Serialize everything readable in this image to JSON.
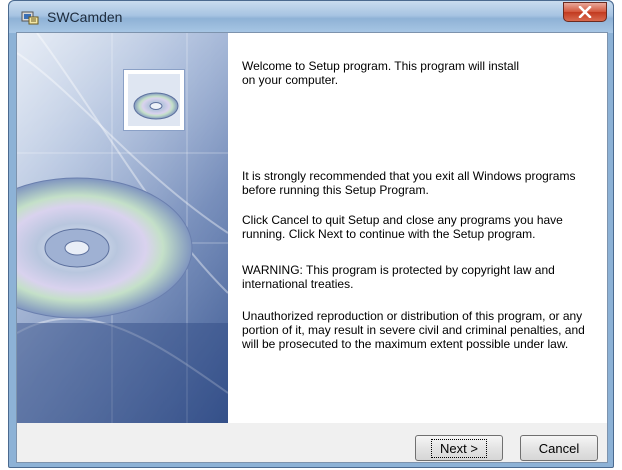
{
  "window": {
    "title": "SWCamden"
  },
  "content": {
    "paragraphs": [
      "Welcome to  Setup program. This program will install\n on your computer.",
      "It is strongly recommended that you exit all Windows programs\nbefore running this Setup Program.",
      "Click Cancel to quit Setup and close any programs you have\nrunning.  Click Next to continue with the Setup program.",
      "WARNING: This program is protected by copyright law and\ninternational treaties.",
      "Unauthorized reproduction or distribution of this program, or any\nportion of it, may result in severe civil and criminal penalties, and\nwill be prosecuted to the maximum extent possible under law."
    ]
  },
  "buttons": {
    "next_label": "Next >",
    "cancel_label": "Cancel"
  },
  "icons": {
    "app": "setup-app-icon",
    "close": "close-icon",
    "cd_small": "cd-icon",
    "cd_large": "cd-disc-graphic"
  },
  "colors": {
    "close_button": "#c9452a",
    "titlebar": "#a7c4e2",
    "banner": "#5b77ad"
  }
}
